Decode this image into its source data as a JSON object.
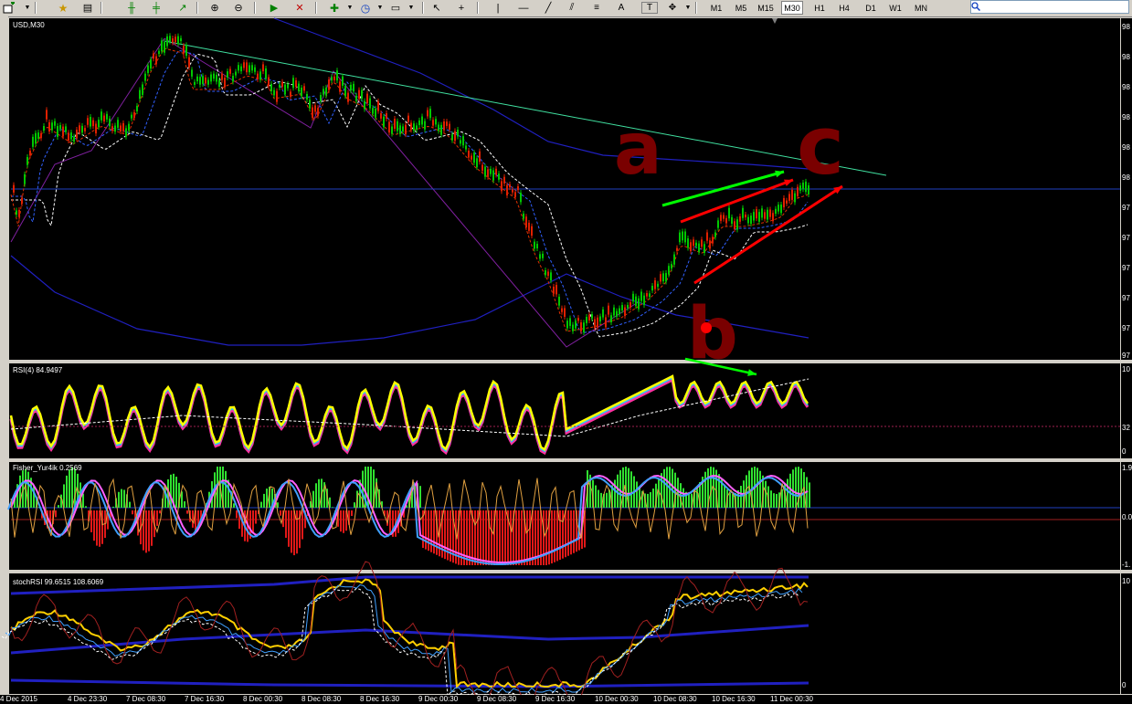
{
  "toolbar": {
    "timeframes": [
      "M1",
      "M5",
      "M15",
      "M30",
      "H1",
      "H4",
      "D1",
      "W1",
      "MN"
    ],
    "active_timeframe": "M30",
    "text_tool": "A",
    "label_tool": "T"
  },
  "main_chart": {
    "title": "USD,M30",
    "annotations": [
      "a",
      "b",
      "c"
    ]
  },
  "rsi": {
    "title": "RSI(4) 84.9497",
    "ticks": [
      "10",
      "32",
      "0"
    ]
  },
  "fisher": {
    "title": "Fisher_Yur4ik 0.2569",
    "ticks": [
      "1.9",
      "0.0",
      "-1."
    ]
  },
  "stoch": {
    "title": "stochRSI 99.6515 108.6069",
    "ticks": [
      "10",
      "0"
    ]
  },
  "main_ticks": [
    "98",
    "98",
    "98",
    "98",
    "98",
    "98",
    "97",
    "97",
    "97",
    "97",
    "97",
    "97"
  ],
  "x_axis": [
    "4 Dec 2015",
    "4 Dec 23:30",
    "7 Dec 08:30",
    "7 Dec 16:30",
    "8 Dec 00:30",
    "8 Dec 08:30",
    "8 Dec 16:30",
    "9 Dec 00:30",
    "9 Dec 08:30",
    "9 Dec 16:30",
    "10 Dec 00:30",
    "10 Dec 08:30",
    "10 Dec 16:30",
    "11 Dec 00:30"
  ],
  "colors": {
    "bull": "#00c800",
    "bear": "#e02000",
    "rsi": "#ffff00",
    "annotation": "#7a0000",
    "arrow_red": "#ff0000",
    "arrow_green": "#00ff00",
    "band": "#2020c0"
  }
}
